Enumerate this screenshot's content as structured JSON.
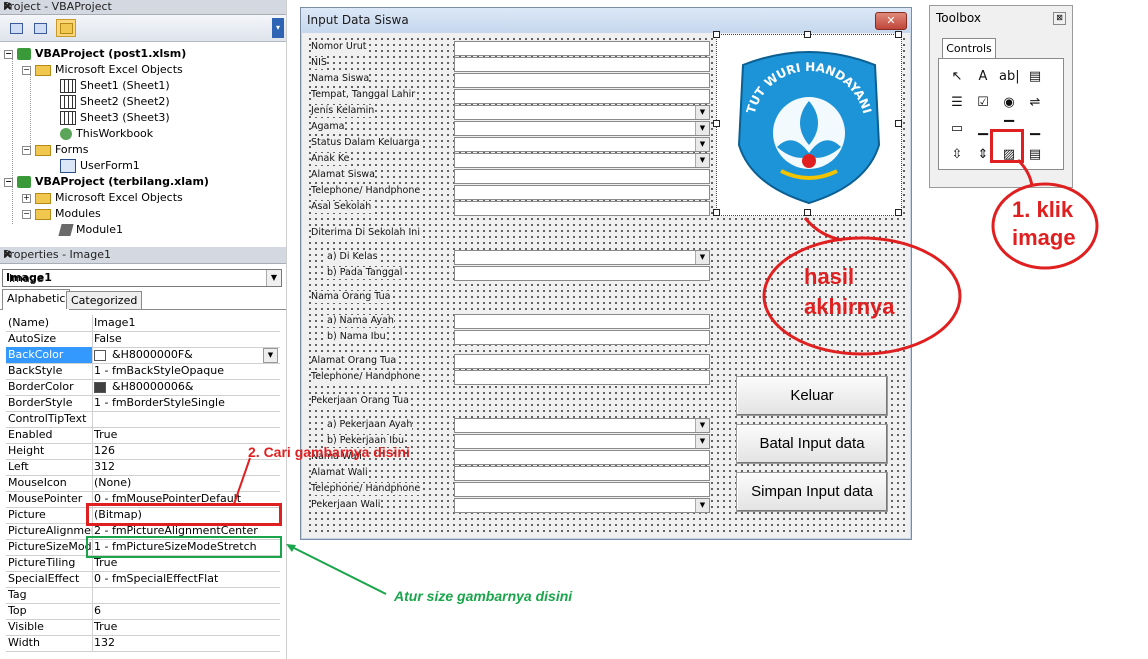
{
  "project": {
    "title": "Project - VBAProject",
    "close": "✖",
    "tree": [
      {
        "label": "VBAProject (post1.xlsm)",
        "bold": true
      },
      {
        "label": "Microsoft Excel Objects"
      },
      {
        "label": "Sheet1 (Sheet1)"
      },
      {
        "label": "Sheet2 (Sheet2)"
      },
      {
        "label": "Sheet3 (Sheet3)"
      },
      {
        "label": "ThisWorkbook"
      },
      {
        "label": "Forms"
      },
      {
        "label": "UserForm1"
      },
      {
        "label": "VBAProject (terbilang.xlam)",
        "bold": true
      },
      {
        "label": "Microsoft Excel Objects"
      },
      {
        "label": "Modules"
      },
      {
        "label": "Module1"
      }
    ]
  },
  "properties": {
    "title": "Properties - Image1",
    "close": "✖",
    "object_name": "Image1",
    "object_type": "Image",
    "tabs": [
      "Alphabetic",
      "Categorized"
    ],
    "rows": [
      {
        "name": "(Name)",
        "value": "Image1"
      },
      {
        "name": "AutoSize",
        "value": "False"
      },
      {
        "name": "BackColor",
        "value": "&H8000000F&",
        "swatch": "#ffffff",
        "highlight": true
      },
      {
        "name": "BackStyle",
        "value": "1 - fmBackStyleOpaque"
      },
      {
        "name": "BorderColor",
        "value": "&H80000006&",
        "swatch": "#404040"
      },
      {
        "name": "BorderStyle",
        "value": "1 - fmBorderStyleSingle"
      },
      {
        "name": "ControlTipText",
        "value": ""
      },
      {
        "name": "Enabled",
        "value": "True"
      },
      {
        "name": "Height",
        "value": "126"
      },
      {
        "name": "Left",
        "value": "312"
      },
      {
        "name": "MouseIcon",
        "value": "(None)"
      },
      {
        "name": "MousePointer",
        "value": "0 - fmMousePointerDefault"
      },
      {
        "name": "Picture",
        "value": "(Bitmap)"
      },
      {
        "name": "PictureAlignment",
        "value": "2 - fmPictureAlignmentCenter"
      },
      {
        "name": "PictureSizeMode",
        "value": "1 - fmPictureSizeModeStretch"
      },
      {
        "name": "PictureTiling",
        "value": "True"
      },
      {
        "name": "SpecialEffect",
        "value": "0 - fmSpecialEffectFlat"
      },
      {
        "name": "Tag",
        "value": ""
      },
      {
        "name": "Top",
        "value": "6"
      },
      {
        "name": "Visible",
        "value": "True"
      },
      {
        "name": "Width",
        "value": "132"
      }
    ]
  },
  "userform": {
    "title": "Input Data Siswa",
    "close": "✕",
    "fields": [
      {
        "label": "Nomor Urut",
        "type": "text"
      },
      {
        "label": "NIS",
        "type": "text"
      },
      {
        "label": "Nama Siswa",
        "type": "text"
      },
      {
        "label": "Tempat, Tanggal Lahir",
        "type": "text"
      },
      {
        "label": "Jenis Kelamin",
        "type": "combo"
      },
      {
        "label": "Agama",
        "type": "combo"
      },
      {
        "label": "Status Dalam Keluarga",
        "type": "combo"
      },
      {
        "label": "Anak Ke",
        "type": "combo"
      },
      {
        "label": "Alamat Siswa",
        "type": "text"
      },
      {
        "label": "Telephone/ Handphone",
        "type": "text"
      },
      {
        "label": "Asal Sekolah",
        "type": "text"
      }
    ],
    "sections": {
      "diterima": "Diterima Di Sekolah Ini",
      "di_kelas": "a)  Di Kelas",
      "pada_tanggal": "b)  Pada Tanggal",
      "nama_orang_tua": "Nama Orang Tua",
      "nama_ayah": "a)  Nama Ayah",
      "nama_ibu": "b)  Nama Ibu",
      "alamat_orang_tua": "Alamat Orang Tua",
      "telephone_ortu": "Telephone/ Handphone",
      "pekerjaan_orang_tua": "Pekerjaan Orang Tua",
      "pekerjaan_ayah": "a)  Pekerjaan Ayah",
      "pekerjaan_ibu": "b)  Pekerjaan Ibu",
      "nama_wali": "Nama Wali",
      "alamat_wali": "Alamat Wali",
      "telephone_wali": "Telephone/ Handphone",
      "pekerjaan_wali": "Pekerjaan Wali"
    },
    "logo_text": "TUT WURI HANDAYANI",
    "buttons": {
      "keluar": "Keluar",
      "batal": "Batal Input data",
      "simpan": "Simpan Input data"
    }
  },
  "toolbox": {
    "title": "Toolbox",
    "close": "⊠",
    "tab": "Controls",
    "tools": [
      "↖",
      "A",
      "ab|",
      "▤",
      "☰",
      "☑",
      "◉",
      "⇌",
      "▭",
      "▁",
      "▔",
      "▁",
      "⇳",
      "⇕",
      "▨",
      "▤"
    ]
  },
  "annotations": {
    "klik_image": "1. klik\nimage",
    "hasil": "hasil\nakhirnya",
    "cari": "2. Cari gambarnya disini",
    "atur": "Atur size gambarnya disini"
  },
  "colors": {
    "annotation_red": "#e02020",
    "annotation_green": "#1aa54a",
    "property_highlight": "#3399ff"
  }
}
